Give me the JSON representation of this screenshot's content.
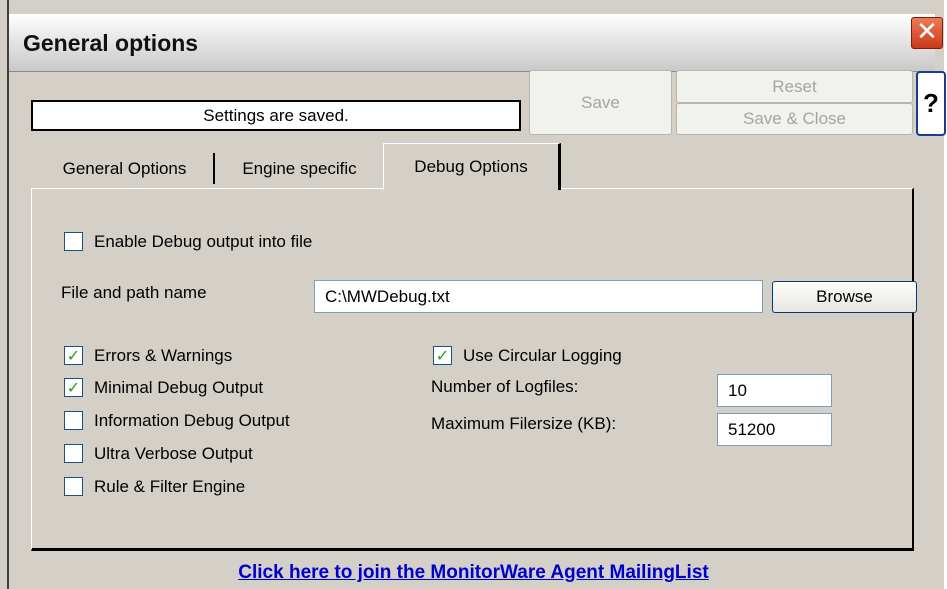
{
  "window": {
    "title": "General options",
    "close_symbol": "✕",
    "status_text": "Settings are saved.",
    "buttons": {
      "save": "Save",
      "reset": "Reset",
      "save_close": "Save & Close",
      "help": "?"
    }
  },
  "tabs": [
    {
      "label": "General Options",
      "selected": false
    },
    {
      "label": "Engine specific",
      "selected": false
    },
    {
      "label": "Debug Options",
      "selected": true
    }
  ],
  "debug": {
    "enable_output": {
      "label": "Enable Debug output into file",
      "checked": false
    },
    "file_path": {
      "label": "File and path name",
      "value": "C:\\MWDebug.txt"
    },
    "browse_label": "Browse",
    "levels": [
      {
        "label": "Errors & Warnings",
        "checked": true
      },
      {
        "label": "Minimal Debug Output",
        "checked": true
      },
      {
        "label": "Information Debug Output",
        "checked": false
      },
      {
        "label": "Ultra Verbose Output",
        "checked": false
      },
      {
        "label": "Rule & Filter Engine",
        "checked": false
      }
    ],
    "circular_logging": {
      "label": "Use Circular Logging",
      "checked": true
    },
    "num_logfiles": {
      "label": "Number of Logfiles:",
      "value": "10"
    },
    "max_filesize": {
      "label": "Maximum Filersize (KB):",
      "value": "51200"
    }
  },
  "footer": {
    "link_text": "Click here to join the MonitorWare Agent MailingList"
  },
  "colors": {
    "check": "#20a020",
    "link": "#0000cc",
    "window_bg": "#d4d0c8",
    "close": "#d9512c"
  },
  "icons": {
    "close": "close-icon",
    "check": "checkmark-icon",
    "help": "help-icon"
  }
}
